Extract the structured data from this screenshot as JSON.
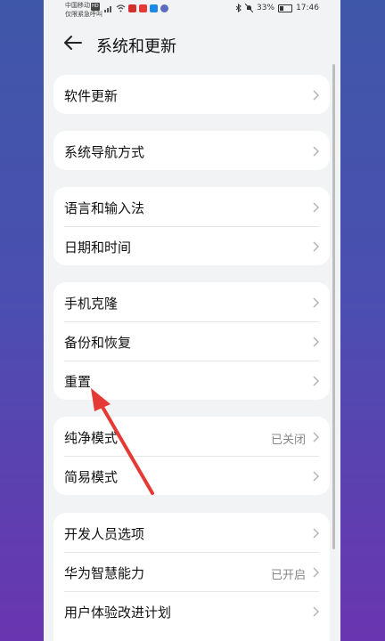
{
  "status_bar": {
    "carrier_line1": "中国移动",
    "carrier_badge": "HD",
    "carrier_line2": "仅限紧急呼叫",
    "battery": "33%",
    "time": "17:46",
    "icons": [
      "signal-4g-icon",
      "wifi-icon",
      "app-icon-1",
      "app-icon-2",
      "app-icon-3",
      "app-icon-4",
      "bluetooth-icon",
      "mute-icon",
      "battery-icon"
    ]
  },
  "header": {
    "title": "系统和更新"
  },
  "groups": [
    {
      "items": [
        {
          "label": "软件更新"
        }
      ]
    },
    {
      "items": [
        {
          "label": "系统导航方式"
        }
      ]
    },
    {
      "items": [
        {
          "label": "语言和输入法"
        },
        {
          "label": "日期和时间"
        }
      ]
    },
    {
      "items": [
        {
          "label": "手机克隆"
        },
        {
          "label": "备份和恢复"
        },
        {
          "label": "重置"
        }
      ]
    },
    {
      "items": [
        {
          "label": "纯净模式",
          "value": "已关闭"
        },
        {
          "label": "简易模式"
        }
      ]
    },
    {
      "items": [
        {
          "label": "开发人员选项"
        },
        {
          "label": "华为智慧能力",
          "value": "已开启"
        },
        {
          "label": "用户体验改进计划"
        }
      ]
    }
  ],
  "colors": {
    "annotation_arrow": "#e53935",
    "accent_bg_top": "#3f57a8",
    "accent_bg_bottom": "#6a35b0"
  }
}
